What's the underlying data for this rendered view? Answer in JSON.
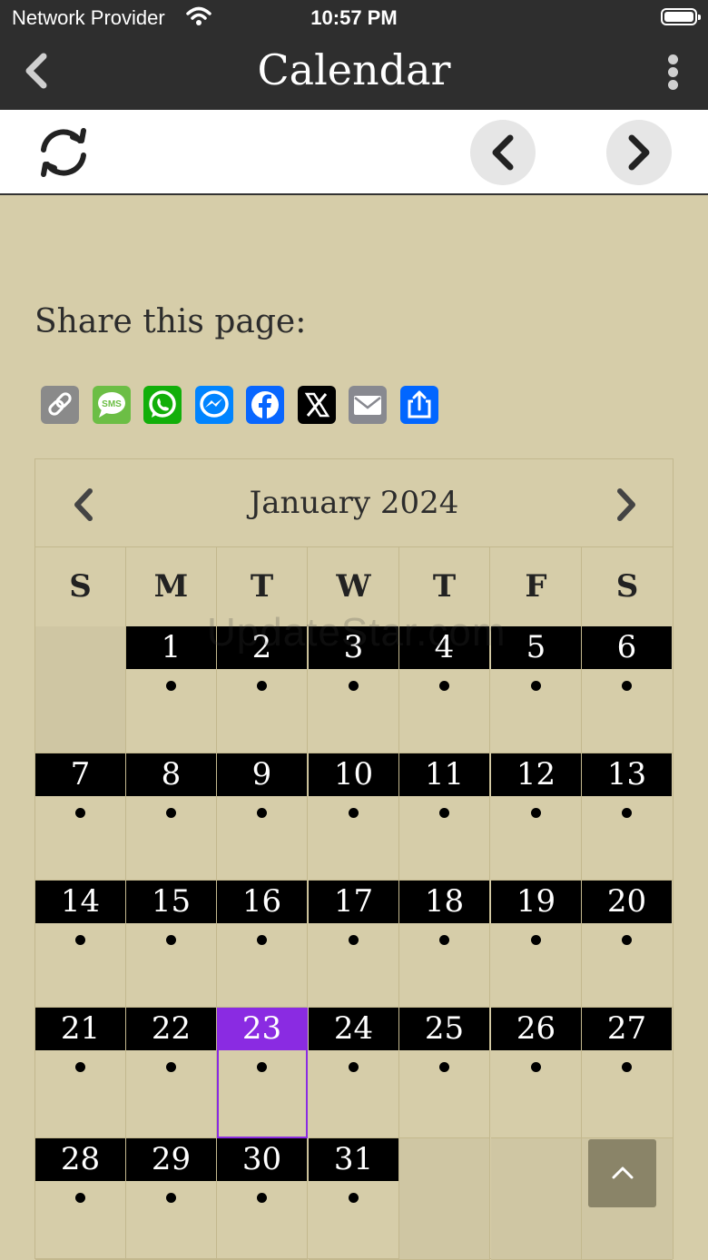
{
  "status_bar": {
    "carrier": "Network Provider",
    "time": "10:57 PM"
  },
  "nav": {
    "title": "Calendar"
  },
  "share": {
    "label": "Share this page:",
    "icons": [
      {
        "name": "copy-link-icon",
        "color": "#8a8a8a"
      },
      {
        "name": "sms-icon",
        "color": "#6cbe45"
      },
      {
        "name": "whatsapp-icon",
        "color": "#12af0a"
      },
      {
        "name": "messenger-icon",
        "color": "#0084ff"
      },
      {
        "name": "facebook-icon",
        "color": "#0866ff"
      },
      {
        "name": "x-icon",
        "color": "#000000"
      },
      {
        "name": "email-icon",
        "color": "#888990"
      },
      {
        "name": "share-icon",
        "color": "#0166ff"
      }
    ]
  },
  "calendar": {
    "month_label": "January 2024",
    "weekdays": [
      "S",
      "M",
      "T",
      "W",
      "T",
      "F",
      "S"
    ],
    "first_weekday_index": 1,
    "days_in_month": 31,
    "today": 23,
    "accent_color": "#8a2be2"
  },
  "watermark": "UpdateStar.com"
}
